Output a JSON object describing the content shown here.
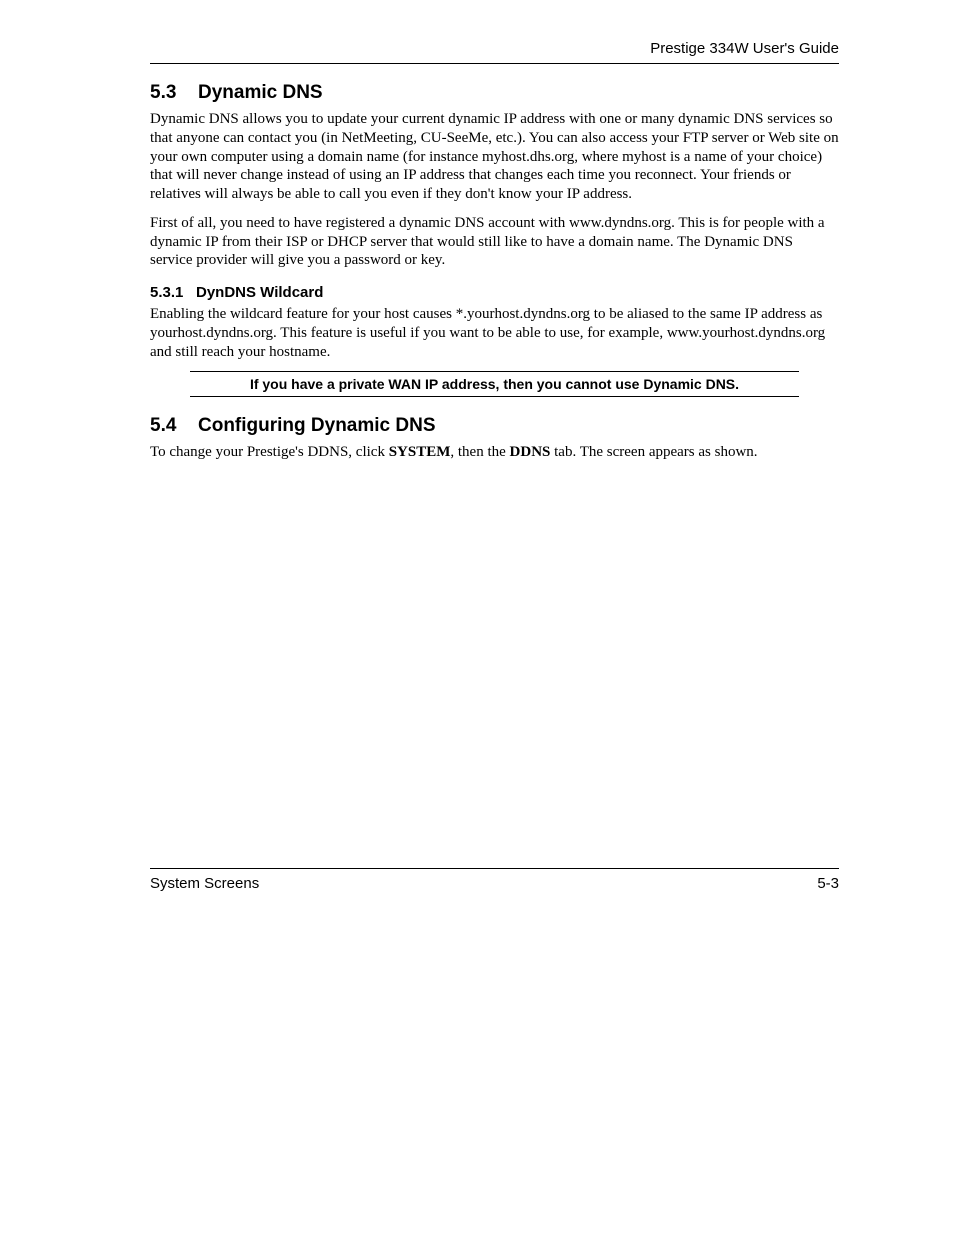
{
  "header": {
    "title": "Prestige 334W User's Guide"
  },
  "section53": {
    "number": "5.3",
    "title": "Dynamic DNS",
    "para1": "Dynamic DNS allows you to update your current dynamic IP address with one or many dynamic DNS services so that anyone can contact you (in NetMeeting, CU-SeeMe, etc.). You can also access your FTP server or Web site on your own computer using a domain name (for instance myhost.dhs.org, where myhost is a name of your choice) that will never change instead of using an IP address that changes each time you reconnect. Your friends or relatives will always be able to call you even if they don't know your IP address.",
    "para2": "First of all, you need to have registered a dynamic DNS account with www.dyndns.org. This is for people with a dynamic IP from their ISP or DHCP server that would still like to have a domain name. The Dynamic DNS service provider will give you a password or key."
  },
  "section531": {
    "number": "5.3.1",
    "title": "DynDNS Wildcard",
    "para1": "Enabling the wildcard feature for your host causes *.yourhost.dyndns.org to be aliased to the same IP address as yourhost.dyndns.org. This feature is useful if you want to be able to use, for example, www.yourhost.dyndns.org and still reach your hostname.",
    "note": "If you have a private WAN IP address, then you cannot use Dynamic DNS."
  },
  "section54": {
    "number": "5.4",
    "title": "Configuring Dynamic DNS",
    "para1_pre": "To change your Prestige's DDNS, click ",
    "para1_b1": "SYSTEM",
    "para1_mid": ", then the ",
    "para1_b2": "DDNS",
    "para1_post": " tab. The screen appears as shown."
  },
  "footer": {
    "left": "System Screens",
    "right": "5-3"
  }
}
